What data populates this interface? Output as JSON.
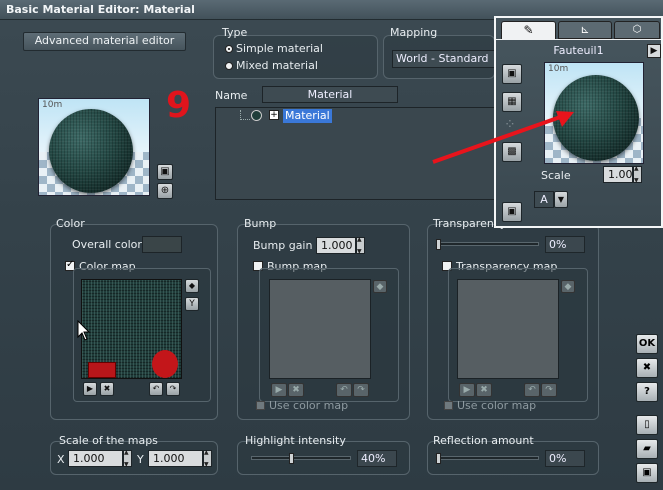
{
  "window": {
    "title": "Basic Material Editor: Material"
  },
  "top": {
    "advanced_button": "Advanced material editor",
    "type_heading": "Type",
    "type_options": [
      "Simple material",
      "Mixed material"
    ],
    "mapping_heading": "Mapping",
    "mapping_value": "World - Standard",
    "name_label": "Name",
    "name_value": "Material",
    "tree_item": "Material",
    "annotation_number": "9",
    "preview_scale_text": "10m"
  },
  "popup": {
    "object_name": "Fauteuil1",
    "preview_scale_text": "10m",
    "scale_label": "Scale",
    "scale_value": "1.00",
    "dropdown_value": "A"
  },
  "color": {
    "heading": "Color",
    "overall_label": "Overall color:",
    "overall_swatch": "#3a4548",
    "map_label": "Color map",
    "map_checked": true
  },
  "bump": {
    "heading": "Bump",
    "gain_label": "Bump gain",
    "gain_value": "1.000",
    "map_label": "Bump map",
    "use_color_label": "Use color map"
  },
  "transparency": {
    "heading": "Transparency",
    "value": "0%",
    "map_label": "Transparency map",
    "use_color_label": "Use color map",
    "slider_fraction": 0
  },
  "scale_maps": {
    "heading": "Scale of the maps",
    "x_label": "X",
    "x_value": "1.000",
    "y_label": "Y",
    "y_value": "1.000"
  },
  "highlight": {
    "heading": "Highlight intensity",
    "value": "40%",
    "slider_fraction": 0.4
  },
  "reflection": {
    "heading": "Reflection amount",
    "value": "0%",
    "slider_fraction": 0
  },
  "side_buttons": {
    "ok": "OK",
    "close": "✖",
    "help": "?"
  },
  "colors": {
    "annotation_red": "#e0141c",
    "arrow_red": "#e8141c",
    "selection_blue": "#3a78d8"
  }
}
